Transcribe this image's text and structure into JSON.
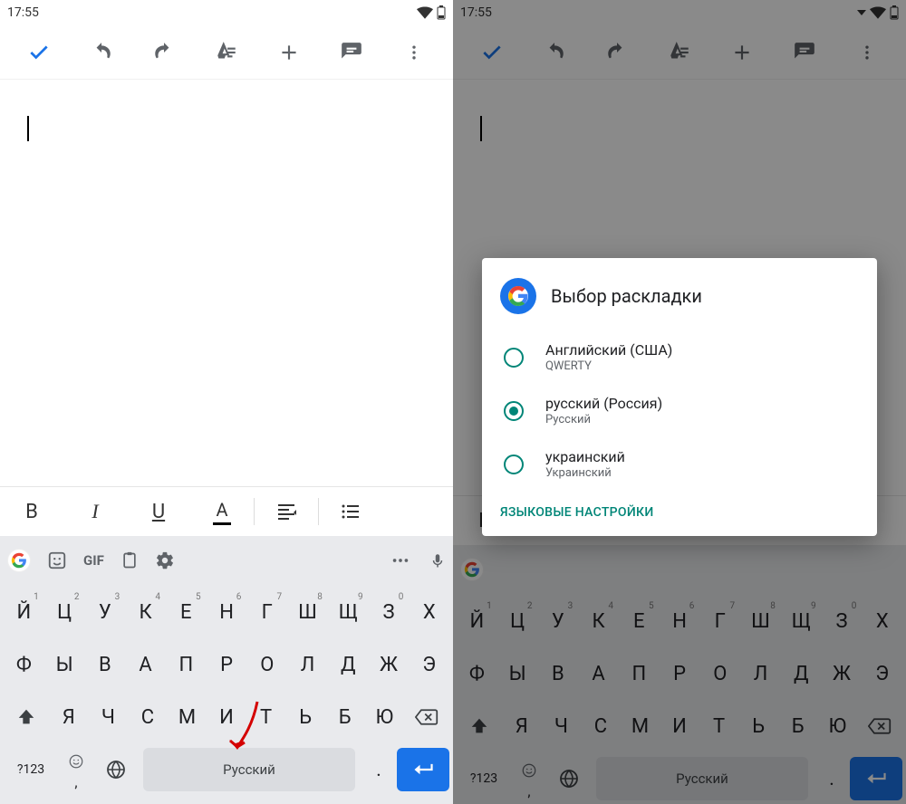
{
  "status": {
    "time": "17:55"
  },
  "suggestions": {
    "gif": "GIF"
  },
  "keyboard": {
    "row1": [
      {
        "c": "Й",
        "n": "1"
      },
      {
        "c": "Ц",
        "n": "2"
      },
      {
        "c": "У",
        "n": "3"
      },
      {
        "c": "К",
        "n": "4"
      },
      {
        "c": "Е",
        "n": "5"
      },
      {
        "c": "Н",
        "n": "6"
      },
      {
        "c": "Г",
        "n": "7"
      },
      {
        "c": "Ш",
        "n": "8"
      },
      {
        "c": "Щ",
        "n": "9"
      },
      {
        "c": "З",
        "n": "0"
      },
      {
        "c": "Х",
        "n": ""
      }
    ],
    "row2": [
      {
        "c": "Ф"
      },
      {
        "c": "Ы"
      },
      {
        "c": "В"
      },
      {
        "c": "А"
      },
      {
        "c": "П"
      },
      {
        "c": "Р"
      },
      {
        "c": "О"
      },
      {
        "c": "Л"
      },
      {
        "c": "Д"
      },
      {
        "c": "Ж"
      },
      {
        "c": "Э"
      }
    ],
    "row3": [
      {
        "c": "Я"
      },
      {
        "c": "Ч"
      },
      {
        "c": "С"
      },
      {
        "c": "М"
      },
      {
        "c": "И"
      },
      {
        "c": "Т"
      },
      {
        "c": "Ь"
      },
      {
        "c": "Б"
      },
      {
        "c": "Ю"
      }
    ],
    "sym": "?123",
    "space": "Русский",
    "period": "."
  },
  "dialog": {
    "title": "Выбор раскладки",
    "options": [
      {
        "primary": "Английский (США)",
        "secondary": "QWERTY",
        "checked": false
      },
      {
        "primary": "русский (Россия)",
        "secondary": "Русский",
        "checked": true
      },
      {
        "primary": "украинский",
        "secondary": "Украинский",
        "checked": false
      }
    ],
    "settings": "ЯЗЫКОВЫЕ НАСТРОЙКИ"
  }
}
